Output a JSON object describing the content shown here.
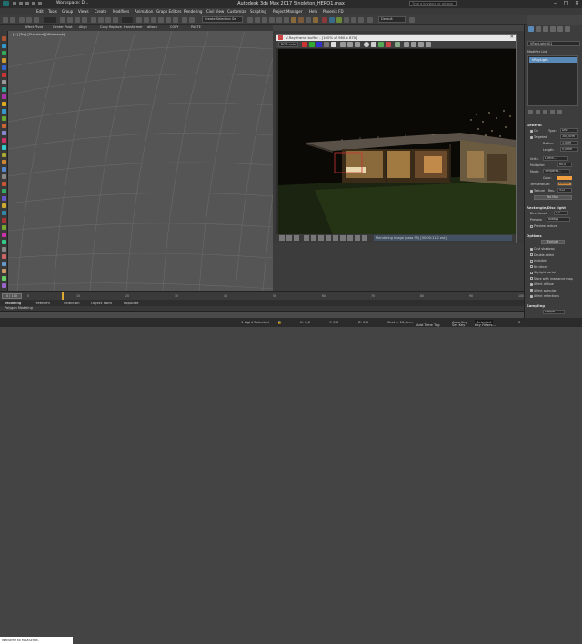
{
  "titlebar": {
    "workspace": "Workspace: D...",
    "title": "Autodesk 3ds Max 2017    Singleton_HERO1.max",
    "search_placeholder": "Type a keyword or phrase",
    "minimize": "–",
    "maximize": "□",
    "close": "✕"
  },
  "menu": [
    "Edit",
    "Tools",
    "Group",
    "Views",
    "Create",
    "Modifiers",
    "Animation",
    "Graph Editors",
    "Rendering",
    "Civil View",
    "Customize",
    "Scripting",
    "Project Manager",
    "Help",
    "Phoenix FD"
  ],
  "toolbar": {
    "selection_set": "Create Selection Se",
    "defaults": "Default"
  },
  "toolbar2": [
    "Affect Pivot",
    "Center Pivot",
    "Align",
    "Copy Replace",
    "transformer",
    "attach",
    "COPY",
    "PASTE"
  ],
  "viewport_left": {
    "label": "[+] [Top] [Standard] [Wireframe]"
  },
  "vfb": {
    "title": "V-Ray frame buffer - [100% of 960 x 870]",
    "channel": "RGB color",
    "status": "Rendering image (pass 95) [00:00:11.2 est]"
  },
  "right_panel": {
    "object_name": "VRayLight001",
    "modifier_list": "Modifier List",
    "stack_item": "VRayLight",
    "sections": {
      "general": "General",
      "rect_disc": "Rectangle/Disc light",
      "options": "Options",
      "sampling": "Sampling"
    },
    "fields": {
      "on": "On",
      "type_label": "Type:",
      "type_value": "Disc",
      "targeted": "Targeted",
      "target_val": "300,0cm",
      "radius": "Radius:",
      "radius_val": "1,00m",
      "length": "Length:",
      "length_val": "0,0mm",
      "units": "Units:",
      "units_val": "Lumin...",
      "multiplier": "Multiplier:",
      "mult_val": "60,0",
      "mode": "Mode:",
      "mode_val": "Temperat...",
      "color": "Color:",
      "temperature": "Temperature:",
      "temp_val": "2800,0",
      "texture": "Texture",
      "res": "Res.",
      "res_val": "512",
      "no_map": "No Map",
      "directional": "Directional:",
      "dir_val": "0,0",
      "preview": "Preview",
      "preview_val": "Always",
      "preview_texture": "Preview texture",
      "exclude": "Exclude",
      "opts": [
        "Cast shadows",
        "Double-sided",
        "Invisible",
        "No decay",
        "Skylight portal",
        "Store with irradiance map",
        "Affect diffuse",
        "Affect specular",
        "Affect reflections"
      ],
      "opts_on": [
        true,
        false,
        false,
        false,
        false,
        false,
        true,
        true,
        true
      ],
      "simple": "Simple"
    }
  },
  "timeline": {
    "position": "0 / 100",
    "ticks": [
      "0",
      "10",
      "20",
      "30",
      "40",
      "50",
      "60",
      "70",
      "80",
      "90",
      "100"
    ],
    "tabs": [
      "Modeling",
      "Freeform",
      "Selection",
      "Object Paint",
      "Populate"
    ],
    "subtab": "Polygon Modeling"
  },
  "status": {
    "listener": "Welcome to MAXScript.",
    "light_selected": "1 Light Selected",
    "grid": "Grid = 10,0cm",
    "x_val": "X: 0,0",
    "y_val": "Y: 0,0",
    "z_val": "Z: 0,0",
    "auto_key": "Auto Key",
    "set_key": "Set Key",
    "selected": "Selected",
    "key_filters": "Key Filters...",
    "add_tag": "Add Time Tag",
    "frame": "0"
  }
}
